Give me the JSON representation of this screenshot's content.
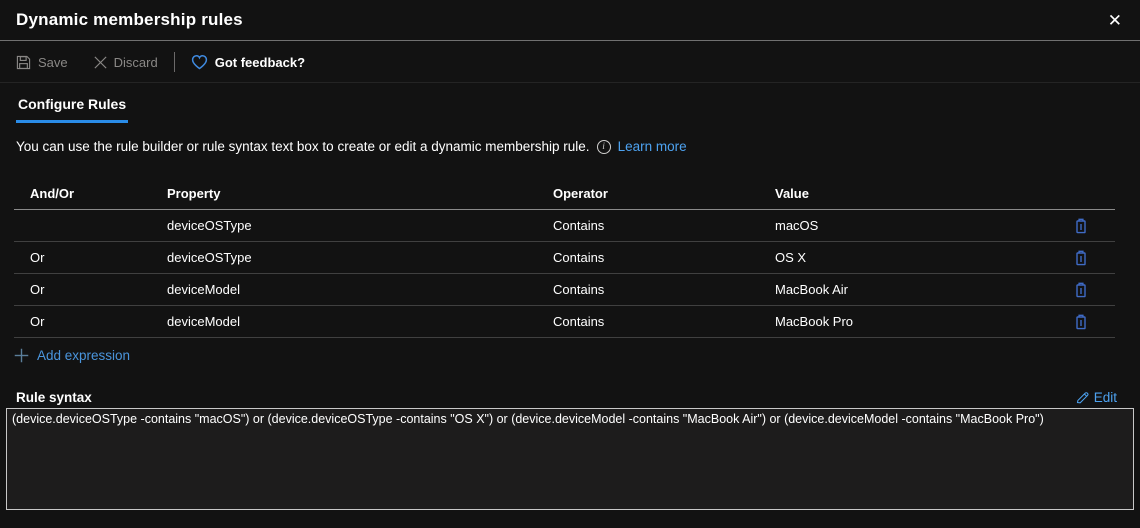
{
  "header": {
    "title": "Dynamic membership rules"
  },
  "toolbar": {
    "save_label": "Save",
    "discard_label": "Discard",
    "feedback_label": "Got feedback?"
  },
  "tab": {
    "label": "Configure Rules"
  },
  "description": {
    "text": "You can use the rule builder or rule syntax text box to create or edit a dynamic membership rule.",
    "learn_more_label": "Learn more"
  },
  "rules_table": {
    "columns": {
      "andor": "And/Or",
      "property": "Property",
      "operator": "Operator",
      "value": "Value"
    },
    "rows": [
      {
        "andor": "",
        "property": "deviceOSType",
        "operator": "Contains",
        "value": "macOS"
      },
      {
        "andor": "Or",
        "property": "deviceOSType",
        "operator": "Contains",
        "value": "OS X"
      },
      {
        "andor": "Or",
        "property": "deviceModel",
        "operator": "Contains",
        "value": "MacBook Air"
      },
      {
        "andor": "Or",
        "property": "deviceModel",
        "operator": "Contains",
        "value": "MacBook Pro"
      }
    ]
  },
  "add_expression_label": "Add expression",
  "rule_syntax": {
    "label": "Rule syntax",
    "edit_label": "Edit",
    "value": "(device.deviceOSType -contains \"macOS\") or (device.deviceOSType -contains \"OS X\") or (device.deviceModel -contains \"MacBook Air\") or (device.deviceModel -contains \"MacBook Pro\")"
  },
  "icons": {
    "close_glyph": "✕",
    "info_glyph": "i"
  },
  "colors": {
    "background": "#121212",
    "link_blue": "#4da2f0",
    "tab_accent": "#2a8ce8",
    "trash_blue": "#3f6bc6",
    "heart_blue": "#3f8ae0",
    "disabled_text": "#8a8886"
  }
}
